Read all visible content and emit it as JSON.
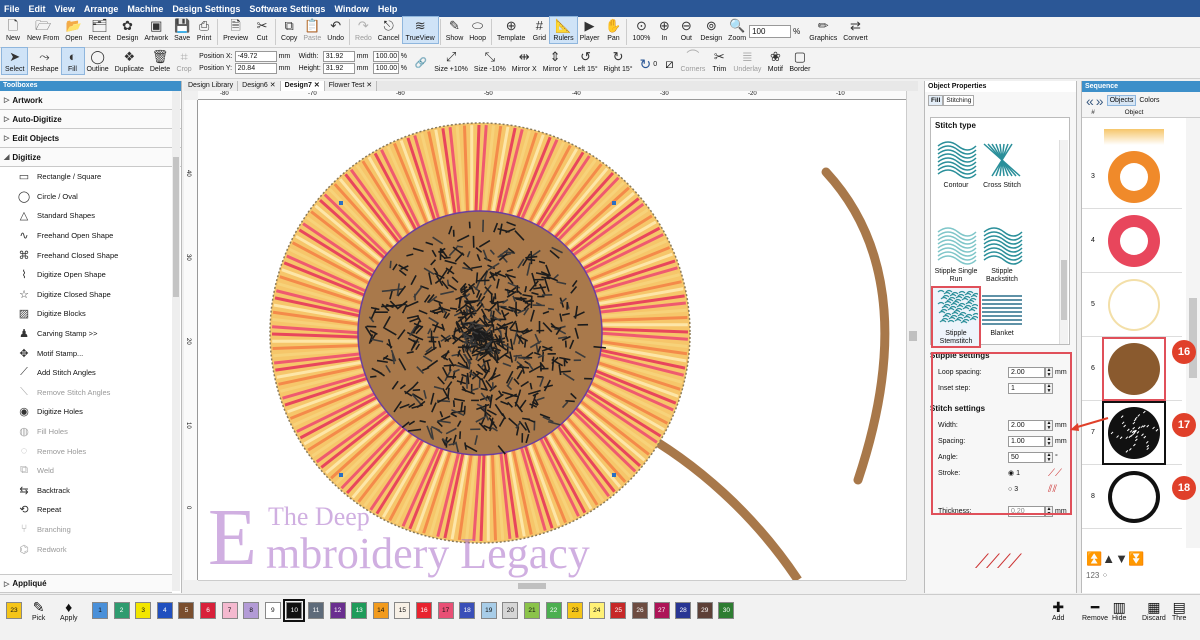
{
  "menu": [
    "File",
    "Edit",
    "View",
    "Arrange",
    "Machine",
    "Design Settings",
    "Software Settings",
    "Window",
    "Help"
  ],
  "toolbar1": [
    {
      "label": "New",
      "icon": "new-file-icon",
      "glyph": "🗋"
    },
    {
      "label": "New From",
      "icon": "new-from-icon",
      "glyph": "🗁"
    },
    {
      "label": "Open",
      "icon": "open-folder-icon",
      "glyph": "📂"
    },
    {
      "label": "Recent",
      "icon": "recent-icon",
      "glyph": "🗂"
    },
    {
      "label": "Design",
      "icon": "design-icon",
      "glyph": "✿"
    },
    {
      "label": "Artwork",
      "icon": "artwork-icon",
      "glyph": "▣"
    },
    {
      "label": "Save",
      "icon": "save-icon",
      "glyph": "💾"
    },
    {
      "label": "Print",
      "icon": "print-icon",
      "glyph": "⎙"
    },
    {
      "label": "Preview",
      "icon": "preview-icon",
      "glyph": "🗎"
    },
    {
      "label": "Cut",
      "icon": "cut-icon",
      "glyph": "✂"
    },
    {
      "label": "Copy",
      "icon": "copy-icon",
      "glyph": "⧉"
    },
    {
      "label": "Paste",
      "icon": "paste-icon",
      "glyph": "📋",
      "disabled": true
    },
    {
      "label": "Undo",
      "icon": "undo-icon",
      "glyph": "↶"
    },
    {
      "label": "Redo",
      "icon": "redo-icon",
      "glyph": "↷",
      "disabled": true
    },
    {
      "label": "Cancel",
      "icon": "cancel-icon",
      "glyph": "⎋"
    },
    {
      "label": "TrueView",
      "icon": "trueview-icon",
      "glyph": "≋",
      "active": true
    },
    {
      "label": "Show",
      "icon": "show-icon",
      "glyph": "✎"
    },
    {
      "label": "Hoop",
      "icon": "hoop-icon",
      "glyph": "⬭"
    },
    {
      "label": "Template",
      "icon": "template-icon",
      "glyph": "⊕"
    },
    {
      "label": "Grid",
      "icon": "grid-icon",
      "glyph": "#"
    },
    {
      "label": "Rulers",
      "icon": "rulers-icon",
      "glyph": "📐",
      "active": true
    },
    {
      "label": "Player",
      "icon": "player-icon",
      "glyph": "▶"
    },
    {
      "label": "Pan",
      "icon": "pan-icon",
      "glyph": "✋"
    },
    {
      "label": "100%",
      "icon": "zoom-100-icon",
      "glyph": "⊙"
    },
    {
      "label": "In",
      "icon": "zoom-in-icon",
      "glyph": "⊕"
    },
    {
      "label": "Out",
      "icon": "zoom-out-icon",
      "glyph": "⊖"
    },
    {
      "label": "Design",
      "icon": "zoom-design-icon",
      "glyph": "⊚"
    },
    {
      "label": "Zoom",
      "icon": "zoom-icon",
      "glyph": "🔍"
    }
  ],
  "zoom_value": "100",
  "zoom_unit": "%",
  "toolbar1_right": [
    {
      "label": "Graphics",
      "icon": "graphics-icon",
      "glyph": "✏"
    },
    {
      "label": "Convert",
      "icon": "convert-icon",
      "glyph": "⇄"
    }
  ],
  "toolbar2_left": [
    {
      "label": "Select",
      "icon": "select-arrow-icon",
      "glyph": "➤",
      "active": true
    },
    {
      "label": "Reshape",
      "icon": "reshape-icon",
      "glyph": "⤳"
    },
    {
      "label": "Fill",
      "icon": "fill-icon",
      "glyph": "◐",
      "active": true
    },
    {
      "label": "Outline",
      "icon": "outline-icon",
      "glyph": "◯"
    },
    {
      "label": "Duplicate",
      "icon": "duplicate-icon",
      "glyph": "❖"
    },
    {
      "label": "Delete",
      "icon": "delete-icon",
      "glyph": "🗑"
    },
    {
      "label": "Crop",
      "icon": "crop-icon",
      "glyph": "⌗",
      "disabled": true
    }
  ],
  "position": {
    "x_label": "Position X:",
    "x": "-49.72",
    "y_label": "Position Y:",
    "y": "20.84",
    "unit": "mm"
  },
  "size": {
    "w_label": "Width:",
    "w": "31.92",
    "h_label": "Height:",
    "h": "31.92",
    "unit": "mm",
    "wp": "100.00",
    "hp": "100.00",
    "pct": "%"
  },
  "toolbar2_right": [
    {
      "label": "Size +10%",
      "icon": "size-up-icon",
      "glyph": "⤢"
    },
    {
      "label": "Size -10%",
      "icon": "size-down-icon",
      "glyph": "⤡"
    },
    {
      "label": "Mirror X",
      "icon": "mirror-x-icon",
      "glyph": "⇹"
    },
    {
      "label": "Mirror Y",
      "icon": "mirror-y-icon",
      "glyph": "⇕"
    },
    {
      "label": "Left 15°",
      "icon": "rotate-left-icon",
      "glyph": "↺"
    },
    {
      "label": "Right 15°",
      "icon": "rotate-right-icon",
      "glyph": "↻"
    }
  ],
  "rotate_value": "0",
  "toolbar2_tail": [
    {
      "label": "Corners",
      "icon": "corners-icon",
      "glyph": "⌒",
      "disabled": true
    },
    {
      "label": "Trim",
      "icon": "trim-icon",
      "glyph": "✂"
    },
    {
      "label": "Underlay",
      "icon": "underlay-icon",
      "glyph": "≣",
      "disabled": true
    },
    {
      "label": "Motif",
      "icon": "motif-icon",
      "glyph": "❀"
    },
    {
      "label": "Border",
      "icon": "border-icon",
      "glyph": "▢"
    }
  ],
  "toolboxes": {
    "title": "Toolboxes",
    "sections": [
      {
        "label": "Artwork",
        "open": false
      },
      {
        "label": "Auto-Digitize",
        "open": false
      },
      {
        "label": "Edit Objects",
        "open": false
      },
      {
        "label": "Digitize",
        "open": true
      }
    ],
    "tools": [
      {
        "label": "Rectangle / Square",
        "icon": "rectangle-icon",
        "glyph": "▭"
      },
      {
        "label": "Circle / Oval",
        "icon": "circle-icon",
        "glyph": "◯"
      },
      {
        "label": "Standard Shapes",
        "icon": "shapes-icon",
        "glyph": "△"
      },
      {
        "label": "Freehand Open Shape",
        "icon": "freehand-open-icon",
        "glyph": "∿"
      },
      {
        "label": "Freehand Closed Shape",
        "icon": "freehand-closed-icon",
        "glyph": "⌘"
      },
      {
        "label": "Digitize Open Shape",
        "icon": "digitize-open-icon",
        "glyph": "⌇"
      },
      {
        "label": "Digitize Closed Shape",
        "icon": "digitize-closed-icon",
        "glyph": "☆"
      },
      {
        "label": "Digitize Blocks",
        "icon": "digitize-blocks-icon",
        "glyph": "▨"
      },
      {
        "label": "Carving Stamp >>",
        "icon": "carving-stamp-icon",
        "glyph": "♟"
      },
      {
        "label": "Motif Stamp...",
        "icon": "motif-stamp-icon",
        "glyph": "✥"
      },
      {
        "label": "Add Stitch Angles",
        "icon": "add-angles-icon",
        "glyph": "⟋"
      },
      {
        "label": "Remove Stitch Angles",
        "icon": "remove-angles-icon",
        "glyph": "⟍",
        "disabled": true
      },
      {
        "label": "Digitize Holes",
        "icon": "digitize-holes-icon",
        "glyph": "◉"
      },
      {
        "label": "Fill Holes",
        "icon": "fill-holes-icon",
        "glyph": "◍",
        "disabled": true
      },
      {
        "label": "Remove Holes",
        "icon": "remove-holes-icon",
        "glyph": "◌",
        "disabled": true
      },
      {
        "label": "Weld",
        "icon": "weld-icon",
        "glyph": "⧉",
        "disabled": true
      },
      {
        "label": "Backtrack",
        "icon": "backtrack-icon",
        "glyph": "⇆"
      },
      {
        "label": "Repeat",
        "icon": "repeat-icon",
        "glyph": "⟲"
      },
      {
        "label": "Branching",
        "icon": "branching-icon",
        "glyph": "⑂",
        "disabled": true
      },
      {
        "label": "Redwork",
        "icon": "redwork-icon",
        "glyph": "⌬",
        "disabled": true
      }
    ],
    "bottom_section": "Appliqué"
  },
  "doc_tabs": [
    "Design Library",
    "Design6",
    "Design7",
    "Flower Test"
  ],
  "active_tab": 2,
  "ruler_h": [
    "-80",
    "-70",
    "-60",
    "-50",
    "-40",
    "-30",
    "-20",
    "-10"
  ],
  "ruler_v": [
    "40",
    "30",
    "20",
    "10",
    "0"
  ],
  "watermark": {
    "line1": "The Deep",
    "line2": "mbroidery Legacy",
    "initial": "E"
  },
  "object_properties": {
    "title": "Object Properties",
    "tabs": [
      "Fill",
      "Stitching"
    ],
    "stitch_type_title": "Stitch type",
    "types": [
      {
        "label": "Contour",
        "icon": "contour-stitch-icon"
      },
      {
        "label": "Cross Stitch",
        "icon": "cross-stitch-icon"
      },
      {
        "label": "Stipple Single Run",
        "icon": "stipple-single-run-icon"
      },
      {
        "label": "Stipple Backstitch",
        "icon": "stipple-backstitch-icon"
      },
      {
        "label": "Stipple Stemstitch",
        "icon": "stipple-stemstitch-icon",
        "selected": true
      },
      {
        "label": "Blanket",
        "icon": "blanket-stitch-icon"
      }
    ],
    "stipple_title": "Stipple settings",
    "loop_spacing_label": "Loop spacing:",
    "loop_spacing": "2.00",
    "loop_unit": "mm",
    "inset_label": "Inset step:",
    "inset": "1",
    "stitch_title": "Stitch settings",
    "width_label": "Width:",
    "width": "2.00",
    "width_unit": "mm",
    "spacing_label": "Spacing:",
    "spacing": "1.00",
    "spacing_unit": "mm",
    "angle_label": "Angle:",
    "angle": "50",
    "angle_unit": "°",
    "stroke_label": "Stroke:",
    "stroke1": "1",
    "stroke3": "3",
    "thickness_label": "Thickness:",
    "thickness": "0.20",
    "thickness_unit": "mm"
  },
  "sequence": {
    "title": "Sequence",
    "tabs": [
      "Objects",
      "Colors"
    ],
    "col_num": "#",
    "col_obj": "Object",
    "rows": [
      {
        "n": "3",
        "kind": "orange-ring"
      },
      {
        "n": "4",
        "kind": "pink-ring"
      },
      {
        "n": "5",
        "kind": "cream-ring"
      },
      {
        "n": "6",
        "kind": "brown-disc"
      },
      {
        "n": "7",
        "kind": "black-stipple",
        "selected": true
      },
      {
        "n": "8",
        "kind": "black-ring"
      }
    ],
    "badges": [
      "16",
      "17",
      "18"
    ],
    "counter": "123"
  },
  "palette": {
    "current": "23",
    "tools": [
      {
        "label": "Pick",
        "icon": "pick-icon",
        "glyph": "✎"
      },
      {
        "label": "Apply",
        "icon": "apply-icon",
        "glyph": "♦"
      }
    ],
    "swatches": [
      {
        "n": "1",
        "c": "#4a90d9"
      },
      {
        "n": "2",
        "c": "#2e9b6f"
      },
      {
        "n": "3",
        "c": "#f2e600"
      },
      {
        "n": "4",
        "c": "#1f4fbf"
      },
      {
        "n": "5",
        "c": "#7a4e2e"
      },
      {
        "n": "6",
        "c": "#d8203a"
      },
      {
        "n": "7",
        "c": "#f4b9cf"
      },
      {
        "n": "8",
        "c": "#b39bd6"
      },
      {
        "n": "9",
        "c": "#ffffff"
      },
      {
        "n": "10",
        "c": "#111111"
      },
      {
        "n": "11",
        "c": "#5e6b7a"
      },
      {
        "n": "12",
        "c": "#6a2f8f"
      },
      {
        "n": "13",
        "c": "#1f9b5a"
      },
      {
        "n": "14",
        "c": "#f29b1e"
      },
      {
        "n": "15",
        "c": "#f7f0e6"
      },
      {
        "n": "16",
        "c": "#e8232f"
      },
      {
        "n": "17",
        "c": "#e84f75"
      },
      {
        "n": "18",
        "c": "#3a4fb8"
      },
      {
        "n": "19",
        "c": "#a8cde8"
      },
      {
        "n": "20",
        "c": "#d6d6d6"
      },
      {
        "n": "21",
        "c": "#8bc34a"
      },
      {
        "n": "22",
        "c": "#4caf50"
      },
      {
        "n": "23",
        "c": "#f5c518"
      },
      {
        "n": "24",
        "c": "#fff176"
      },
      {
        "n": "25",
        "c": "#c62828"
      },
      {
        "n": "26",
        "c": "#6d4c41"
      },
      {
        "n": "27",
        "c": "#ad1457"
      },
      {
        "n": "28",
        "c": "#283593"
      },
      {
        "n": "29",
        "c": "#5d4037"
      },
      {
        "n": "30",
        "c": "#2e7d32"
      }
    ],
    "right_tools": [
      {
        "label": "Add",
        "icon": "add-icon",
        "glyph": "✚"
      },
      {
        "label": "Remove",
        "icon": "remove-icon",
        "glyph": "━"
      },
      {
        "label": "Hide",
        "icon": "hide-icon",
        "glyph": "▥"
      },
      {
        "label": "Discard",
        "icon": "discard-icon",
        "glyph": "▦"
      },
      {
        "label": "Thre",
        "icon": "threads-icon",
        "glyph": "▤"
      }
    ]
  }
}
